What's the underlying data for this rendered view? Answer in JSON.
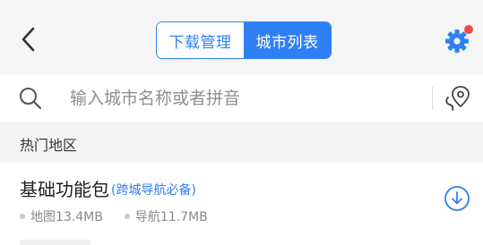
{
  "header": {
    "back_icon": "chevron-left-icon",
    "tabs": [
      {
        "label": "下载管理",
        "active": false
      },
      {
        "label": "城市列表",
        "active": true
      }
    ],
    "settings_icon": "gear-icon",
    "notification_dot_color": "#ee4a4a",
    "accent_color": "#2f80f5"
  },
  "search": {
    "placeholder": "输入城市名称或者拼音",
    "value": "",
    "search_icon": "search-icon",
    "locate_icon": "location-pin-icon"
  },
  "section": {
    "title": "热门地区"
  },
  "list": {
    "items": [
      {
        "title": "基础功能包",
        "tag": "(跨城导航必备)",
        "map_size": "地图13.4MB",
        "nav_size": "导航11.7MB",
        "action_icon": "download-icon"
      }
    ]
  }
}
